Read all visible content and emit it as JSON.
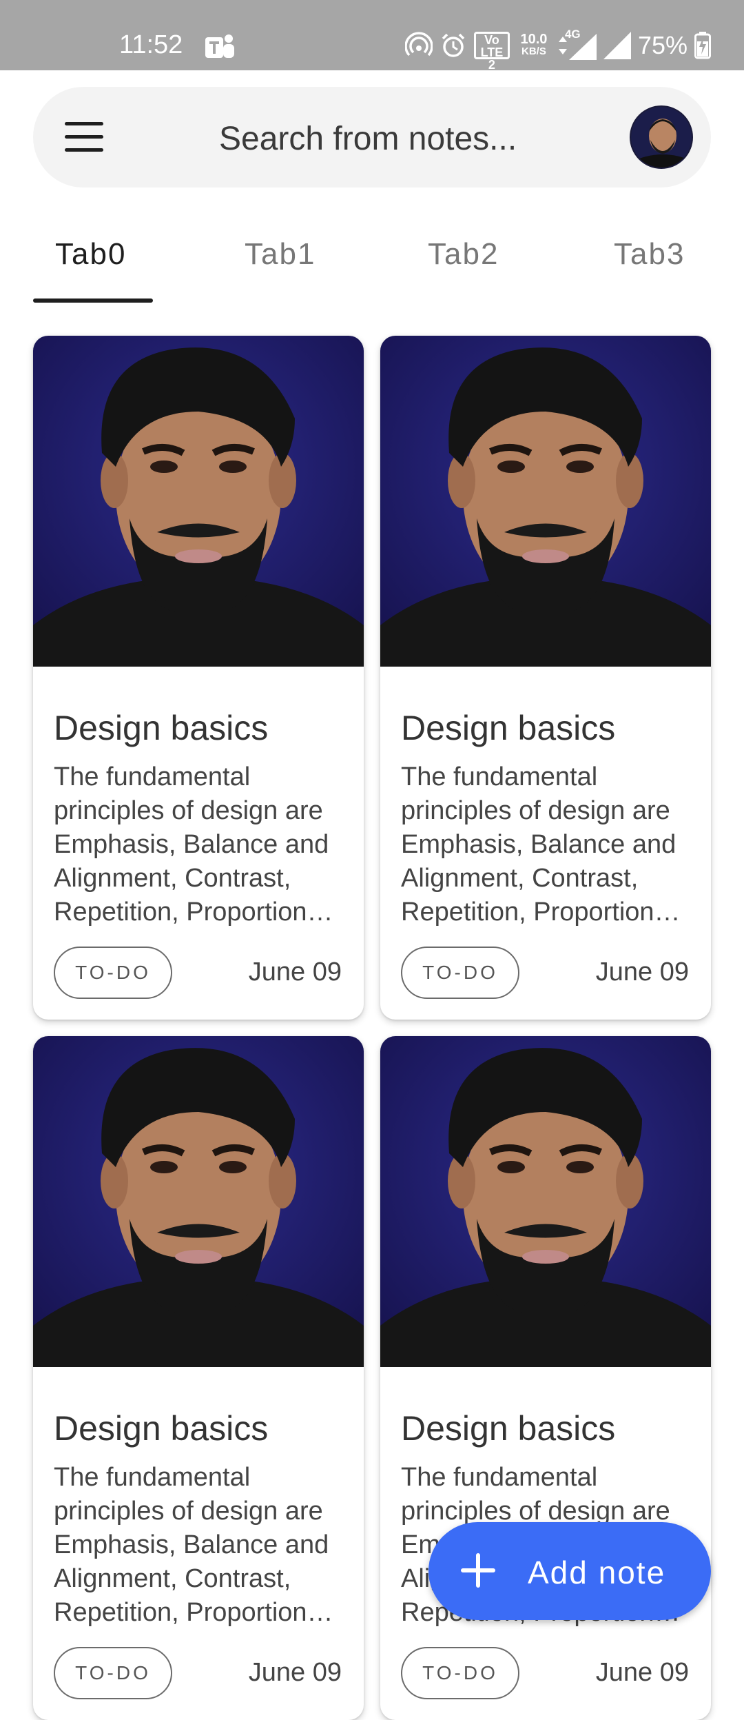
{
  "status_bar": {
    "time": "11:52",
    "net_speed_value": "10.0",
    "net_speed_unit": "KB/S",
    "volte": "Vo",
    "lte": "LTE 2",
    "network": "4G",
    "battery": "75%",
    "icons": [
      "teams-icon",
      "hotspot-icon",
      "alarm-icon",
      "volte-icon",
      "data-arrows-icon",
      "signal-icon",
      "signal-icon",
      "battery-charging-icon"
    ]
  },
  "search": {
    "placeholder": "Search from notes...",
    "menu_icon": "menu-icon",
    "avatar": "avatar"
  },
  "tabs": [
    {
      "label": "Tab0",
      "active": true
    },
    {
      "label": "Tab1",
      "active": false
    },
    {
      "label": "Tab2",
      "active": false
    },
    {
      "label": "Tab3",
      "active": false
    }
  ],
  "notes": [
    {
      "title": "Design basics",
      "body": "The fundamental principles of design are Emphasis, Balance and Alignment, Contrast, Repetition, Proportion…",
      "tag": "TO-DO",
      "date": "June 09"
    },
    {
      "title": "Design basics",
      "body": "The fundamental principles of design are Emphasis, Balance and Alignment, Contrast, Repetition, Proportion…",
      "tag": "TO-DO",
      "date": "June 09"
    },
    {
      "title": "Design basics",
      "body": "The fundamental principles of design are Emphasis, Balance and Alignment, Contrast, Repetition, Proportion…",
      "tag": "TO-DO",
      "date": "June 09"
    },
    {
      "title": "Design basics",
      "body": "The fundamental principles of design are Emphasis, Balance and Alignment, Contrast, Repetition, Proportion…",
      "tag": "TO-DO",
      "date": "June 09"
    }
  ],
  "fab": {
    "label": "Add note",
    "icon": "plus-icon"
  },
  "colors": {
    "accent": "#3b6cf6",
    "status_bar": "#a6a6a6",
    "search_bg": "#f3f3f3",
    "photo_bg": "#1f1a73"
  }
}
